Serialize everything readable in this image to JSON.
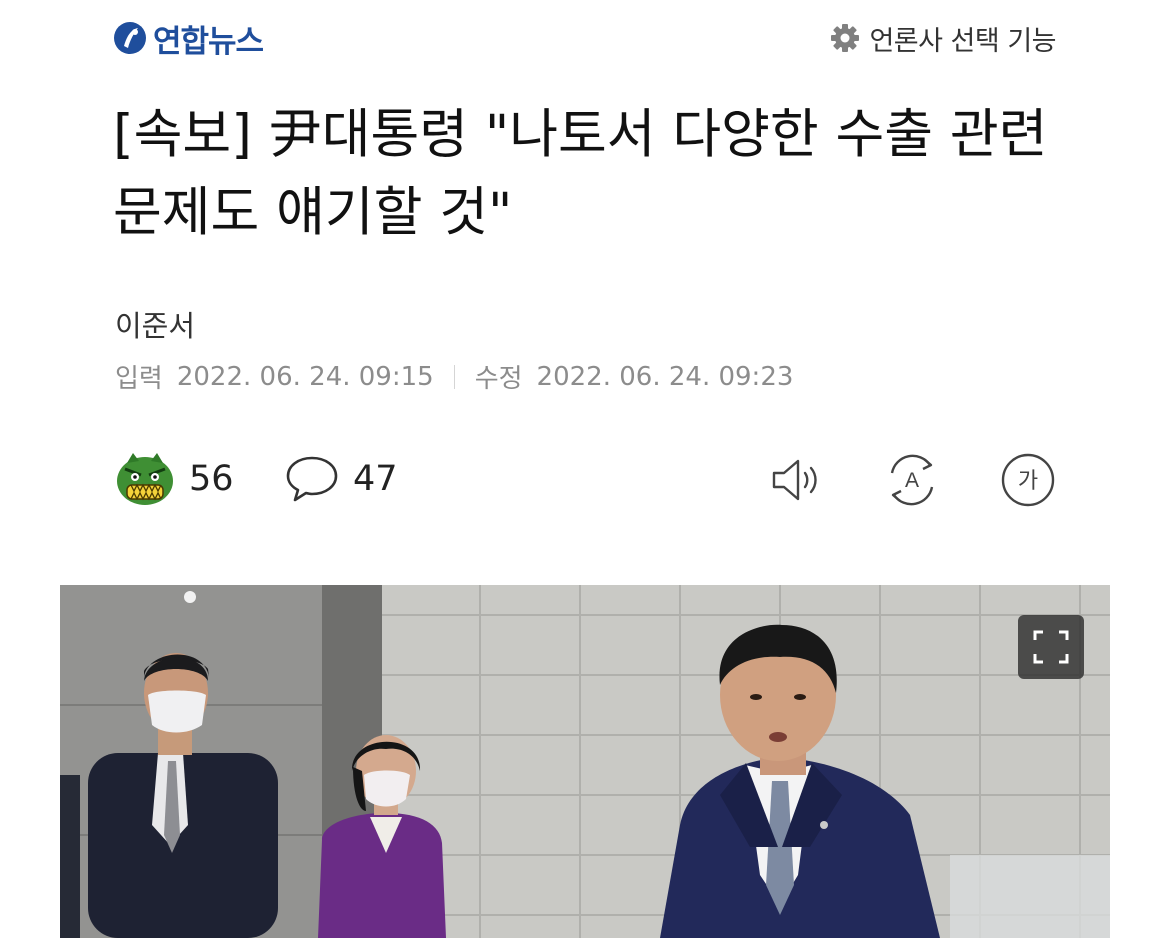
{
  "header": {
    "brand_name": "연합뉴스",
    "brand_color": "#1f4e9c",
    "press_select_label": "언론사 선택 기능",
    "press_select_icon": "gear-icon"
  },
  "article": {
    "headline": "[속보] 尹대통령 \"나토서 다양한 수출 관련 문제도 얘기할 것\"",
    "author": "이준서",
    "published_label": "입력",
    "published_time": "2022. 06. 24. 09:15",
    "modified_label": "수정",
    "modified_time": "2022. 06. 24. 09:23"
  },
  "actions": {
    "reaction_icon": "angry-face-reaction-icon",
    "reaction_count": "56",
    "comment_icon": "speech-bubble-icon",
    "comment_count": "47",
    "tools": [
      "speaker-icon",
      "translate-icon",
      "font-size-icon"
    ]
  },
  "photo": {
    "fullscreen_icon": "fullscreen-icon"
  }
}
